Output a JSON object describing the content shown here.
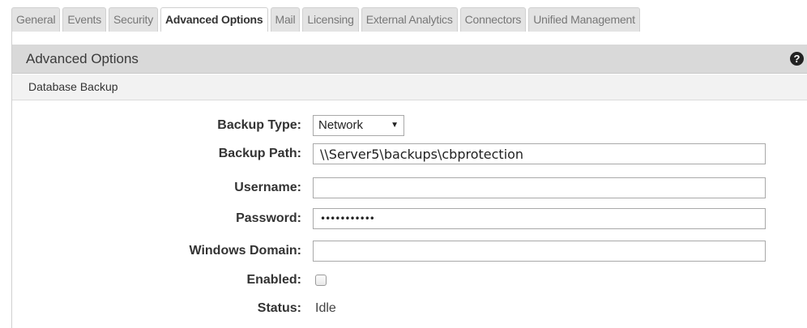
{
  "tabs": [
    {
      "label": "General",
      "active": false
    },
    {
      "label": "Events",
      "active": false
    },
    {
      "label": "Security",
      "active": false
    },
    {
      "label": "Advanced Options",
      "active": true
    },
    {
      "label": "Mail",
      "active": false
    },
    {
      "label": "Licensing",
      "active": false
    },
    {
      "label": "External Analytics",
      "active": false
    },
    {
      "label": "Connectors",
      "active": false
    },
    {
      "label": "Unified Management",
      "active": false
    }
  ],
  "panel": {
    "title": "Advanced Options",
    "help_icon": "question-circle-icon",
    "help_glyph": "?"
  },
  "section": {
    "title": "Database Backup"
  },
  "form": {
    "backup_type": {
      "label": "Backup Type:",
      "value": "Network",
      "arrow": "▼"
    },
    "backup_path": {
      "label": "Backup Path:",
      "value": "\\\\Server5\\backups\\cbprotection"
    },
    "username": {
      "label": "Username:",
      "value": ""
    },
    "password": {
      "label": "Password:",
      "value": "•••••••••••"
    },
    "windows_domain": {
      "label": "Windows Domain:",
      "value": ""
    },
    "enabled": {
      "label": "Enabled:",
      "checked": false
    },
    "status": {
      "label": "Status:",
      "value": "Idle"
    }
  },
  "colors": {
    "tab_bg": "#e3e3e3",
    "panel_header_bg": "#d9d9d9",
    "section_header_bg": "#f2f2f2"
  }
}
